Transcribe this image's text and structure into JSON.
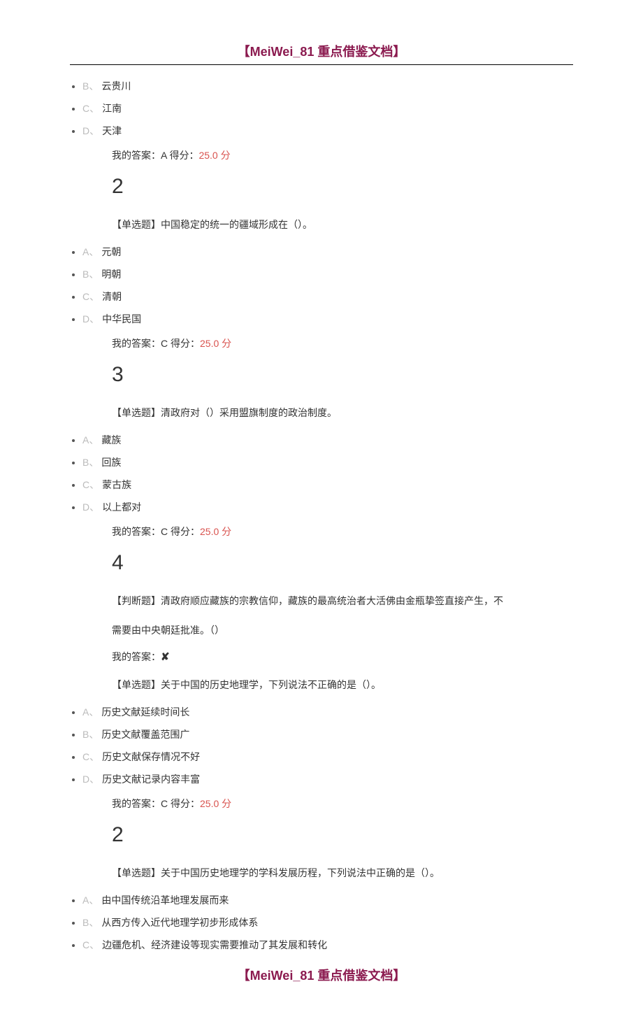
{
  "header": "【MeiWei_81 重点借鉴文档】",
  "footer": "【MeiWei_81 重点借鉴文档】",
  "q1": {
    "options": [
      {
        "letter": "B、",
        "text": "云贵川"
      },
      {
        "letter": "C、",
        "text": "江南"
      },
      {
        "letter": "D、",
        "text": "天津"
      }
    ],
    "answer_prefix": "我的答案：A 得分：",
    "score": "25.0 分"
  },
  "q2": {
    "num": "2",
    "stem": "【单选题】中国稳定的统一的疆域形成在（）。",
    "options": [
      {
        "letter": "A、",
        "text": "元朝"
      },
      {
        "letter": "B、",
        "text": "明朝"
      },
      {
        "letter": "C、",
        "text": "清朝"
      },
      {
        "letter": "D、",
        "text": "中华民国"
      }
    ],
    "answer_prefix": "我的答案：C 得分：",
    "score": "25.0 分"
  },
  "q3": {
    "num": "3",
    "stem": "【单选题】清政府对（）采用盟旗制度的政治制度。",
    "options": [
      {
        "letter": "A、",
        "text": "藏族"
      },
      {
        "letter": "B、",
        "text": "回族"
      },
      {
        "letter": "C、",
        "text": "蒙古族"
      },
      {
        "letter": "D、",
        "text": "以上都对"
      }
    ],
    "answer_prefix": "我的答案：C 得分：",
    "score": "25.0 分"
  },
  "q4": {
    "num": "4",
    "stem_line1": "【判断题】清政府顺应藏族的宗教信仰，藏族的最高统治者大活佛由金瓶挚签直接产生，不",
    "stem_line2": "需要由中央朝廷批准。（）",
    "answer_prefix": "我的答案：",
    "answer_mark": "✘"
  },
  "q5": {
    "stem": "【单选题】关于中国的历史地理学，下列说法不正确的是（）。",
    "options": [
      {
        "letter": "A、",
        "text": "历史文献延续时间长"
      },
      {
        "letter": "B、",
        "text": "历史文献覆盖范围广"
      },
      {
        "letter": "C、",
        "text": "历史文献保存情况不好"
      },
      {
        "letter": "D、",
        "text": "历史文献记录内容丰富"
      }
    ],
    "answer_prefix": "我的答案：C 得分：",
    "score": "25.0 分"
  },
  "q6": {
    "num": "2",
    "stem": "【单选题】关于中国历史地理学的学科发展历程，下列说法中正确的是（）。",
    "options": [
      {
        "letter": "A、",
        "text": "由中国传统沿革地理发展而来"
      },
      {
        "letter": "B、",
        "text": "从西方传入近代地理学初步形成体系"
      },
      {
        "letter": "C、",
        "text": "边疆危机、经济建设等现实需要推动了其发展和转化"
      }
    ]
  }
}
